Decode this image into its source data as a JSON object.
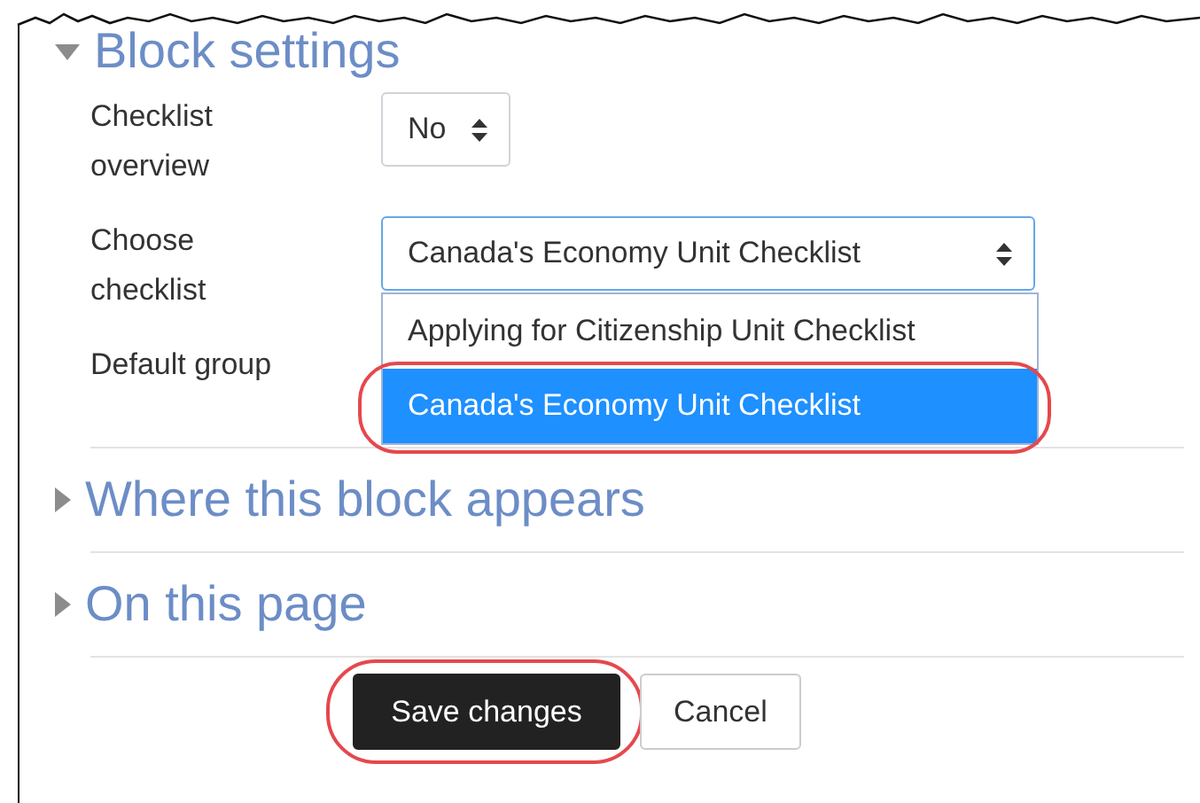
{
  "sections": [
    {
      "title": "Block settings",
      "expanded": true,
      "fields": [
        {
          "kind": "select",
          "label": "Checklist overview",
          "value": "No"
        },
        {
          "kind": "select",
          "label": "Choose checklist",
          "value": "Canada's Economy Unit Checklist",
          "open": true,
          "options": [
            {
              "label": "Applying for Citizenship Unit Checklist",
              "selected": false
            },
            {
              "label": "Canada's Economy Unit Checklist",
              "selected": true
            }
          ]
        },
        {
          "kind": "select",
          "label": "Default group"
        }
      ]
    },
    {
      "title": "Where this block appears",
      "expanded": false
    },
    {
      "title": "On this page",
      "expanded": false
    }
  ],
  "buttons": [
    {
      "label": "Save changes",
      "kind": "primary",
      "highlighted": true
    },
    {
      "label": "Cancel",
      "kind": "secondary",
      "highlighted": false
    }
  ]
}
